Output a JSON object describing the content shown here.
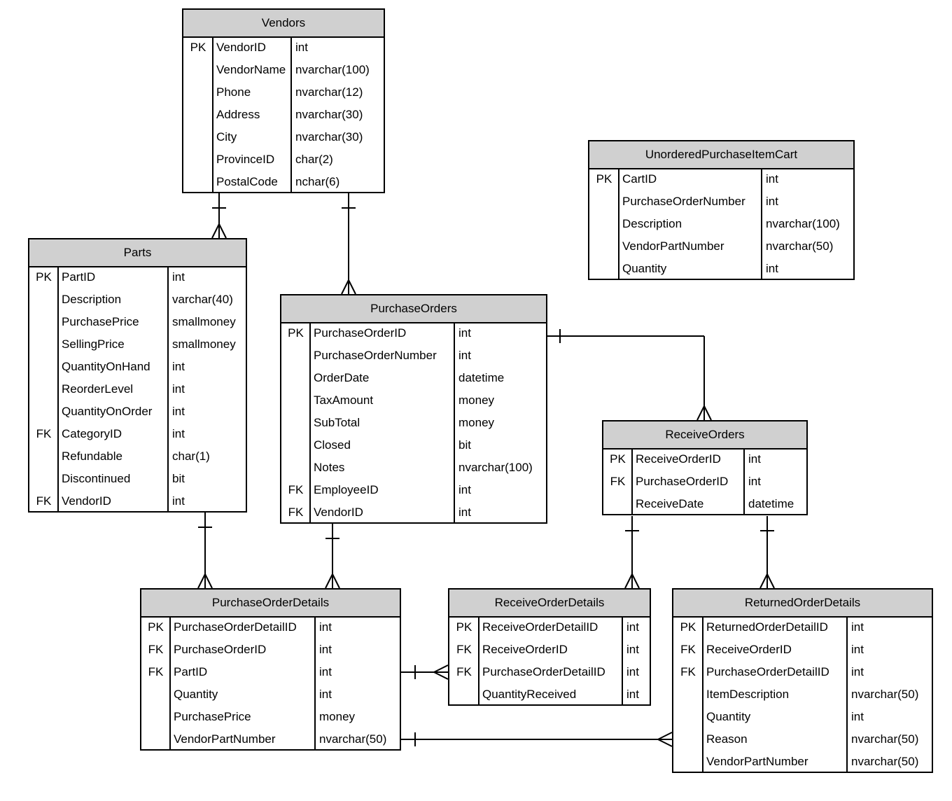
{
  "tables": [
    {
      "id": "vendors",
      "title": "Vendors",
      "rows": [
        [
          "PK",
          "VendorID",
          "int"
        ],
        [
          "",
          "VendorName",
          "nvarchar(100)"
        ],
        [
          "",
          "Phone",
          "nvarchar(12)"
        ],
        [
          "",
          "Address",
          "nvarchar(30)"
        ],
        [
          "",
          "City",
          "nvarchar(30)"
        ],
        [
          "",
          "ProvinceID",
          "char(2)"
        ],
        [
          "",
          "PostalCode",
          "nchar(6)"
        ]
      ]
    },
    {
      "id": "unordered",
      "title": "UnorderedPurchaseItemCart",
      "rows": [
        [
          "PK",
          "CartID",
          "int"
        ],
        [
          "",
          "PurchaseOrderNumber",
          "int"
        ],
        [
          "",
          "Description",
          "nvarchar(100)"
        ],
        [
          "",
          "VendorPartNumber",
          "nvarchar(50)"
        ],
        [
          "",
          "Quantity",
          "int"
        ]
      ]
    },
    {
      "id": "parts",
      "title": "Parts",
      "rows": [
        [
          "PK",
          "PartID",
          "int"
        ],
        [
          "",
          "Description",
          "varchar(40)"
        ],
        [
          "",
          "PurchasePrice",
          "smallmoney"
        ],
        [
          "",
          "SellingPrice",
          "smallmoney"
        ],
        [
          "",
          "QuantityOnHand",
          "int"
        ],
        [
          "",
          "ReorderLevel",
          "int"
        ],
        [
          "",
          "QuantityOnOrder",
          "int"
        ],
        [
          "FK",
          "CategoryID",
          "int"
        ],
        [
          "",
          "Refundable",
          "char(1)"
        ],
        [
          "",
          "Discontinued",
          "bit"
        ],
        [
          "FK",
          "VendorID",
          "int"
        ]
      ]
    },
    {
      "id": "purchaseorders",
      "title": "PurchaseOrders",
      "rows": [
        [
          "PK",
          "PurchaseOrderID",
          "int"
        ],
        [
          "",
          "PurchaseOrderNumber",
          "int"
        ],
        [
          "",
          "OrderDate",
          "datetime"
        ],
        [
          "",
          "TaxAmount",
          "money"
        ],
        [
          "",
          "SubTotal",
          "money"
        ],
        [
          "",
          "Closed",
          "bit"
        ],
        [
          "",
          "Notes",
          "nvarchar(100)"
        ],
        [
          "FK",
          "EmployeeID",
          "int"
        ],
        [
          "FK",
          "VendorID",
          "int"
        ]
      ]
    },
    {
      "id": "receiveorders",
      "title": "ReceiveOrders",
      "rows": [
        [
          "PK",
          "ReceiveOrderID",
          "int"
        ],
        [
          "FK",
          "PurchaseOrderID",
          "int"
        ],
        [
          "",
          "ReceiveDate",
          "datetime"
        ]
      ]
    },
    {
      "id": "purchaseorderdetails",
      "title": "PurchaseOrderDetails",
      "rows": [
        [
          "PK",
          "PurchaseOrderDetailID",
          "int"
        ],
        [
          "FK",
          "PurchaseOrderID",
          "int"
        ],
        [
          "FK",
          "PartID",
          "int"
        ],
        [
          "",
          "Quantity",
          "int"
        ],
        [
          "",
          "PurchasePrice",
          "money"
        ],
        [
          "",
          "VendorPartNumber",
          "nvarchar(50)"
        ]
      ]
    },
    {
      "id": "receiveorderdetails",
      "title": "ReceiveOrderDetails",
      "rows": [
        [
          "PK",
          "ReceiveOrderDetailID",
          "int"
        ],
        [
          "FK",
          "ReceiveOrderID",
          "int"
        ],
        [
          "FK",
          "PurchaseOrderDetailID",
          "int"
        ],
        [
          "",
          "QuantityReceived",
          "int"
        ]
      ]
    },
    {
      "id": "returnedorderdetails",
      "title": "ReturnedOrderDetails",
      "rows": [
        [
          "PK",
          "ReturnedOrderDetailID",
          "int"
        ],
        [
          "FK",
          "ReceiveOrderID",
          "int"
        ],
        [
          "FK",
          "PurchaseOrderDetailID",
          "int"
        ],
        [
          "",
          "ItemDescription",
          "nvarchar(50)"
        ],
        [
          "",
          "Quantity",
          "int"
        ],
        [
          "",
          "Reason",
          "nvarchar(50)"
        ],
        [
          "",
          "VendorPartNumber",
          "nvarchar(50)"
        ]
      ]
    }
  ],
  "relationships": [
    {
      "from": "vendors",
      "to": "parts",
      "cardinality": "one-to-many"
    },
    {
      "from": "vendors",
      "to": "purchaseorders",
      "cardinality": "one-to-many"
    },
    {
      "from": "purchaseorders",
      "to": "receiveorders",
      "cardinality": "one-to-many"
    },
    {
      "from": "parts",
      "to": "purchaseorderdetails",
      "cardinality": "one-to-many"
    },
    {
      "from": "purchaseorders",
      "to": "purchaseorderdetails",
      "cardinality": "one-to-many"
    },
    {
      "from": "receiveorders",
      "to": "receiveorderdetails",
      "cardinality": "one-to-many"
    },
    {
      "from": "receiveorders",
      "to": "returnedorderdetails",
      "cardinality": "one-to-many"
    },
    {
      "from": "purchaseorderdetails",
      "to": "receiveorderdetails",
      "cardinality": "one-to-many"
    },
    {
      "from": "purchaseorderdetails",
      "to": "returnedorderdetails",
      "cardinality": "one-to-many"
    }
  ],
  "colors": {
    "header": "#d0d0d0",
    "line": "#000000"
  }
}
